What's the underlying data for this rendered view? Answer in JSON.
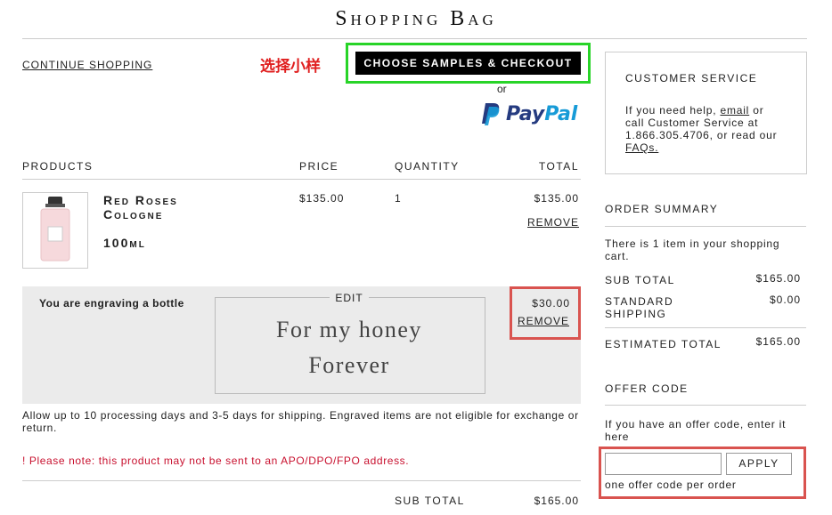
{
  "page": {
    "title": "Shopping Bag"
  },
  "top": {
    "continue_label": "CONTINUE SHOPPING",
    "annotation_cn": "选择小样",
    "checkout_label": "CHOOSE SAMPLES & CHECKOUT",
    "or": "or",
    "paypal_pay": "Pay",
    "paypal_pal": "Pal"
  },
  "table": {
    "headers": {
      "products": "PRODUCTS",
      "price": "PRICE",
      "quantity": "QUANTITY",
      "total": "TOTAL"
    },
    "item": {
      "name_line1": "Red Roses",
      "name_line2": "Cologne",
      "size": "100ml",
      "price": "$135.00",
      "quantity": "1",
      "total": "$135.00",
      "remove": "REMOVE"
    },
    "engraving": {
      "label": "You are engraving a bottle",
      "edit": "EDIT",
      "line1": "For my honey",
      "line2": "Forever",
      "price": "$30.00",
      "remove": "REMOVE"
    },
    "shipping_note": "Allow up to 10 processing days and 3-5 days for shipping. Engraved items are not eligible for exchange or return.",
    "apo_note": "! Please note: this product may not be sent to an APO/DPO/FPO address.",
    "sub_total_label": "SUB TOTAL",
    "sub_total_value": "$165.00"
  },
  "customer_service": {
    "title": "CUSTOMER SERVICE",
    "text_before": "If you need help, ",
    "email": "email",
    "text_middle": " or call Customer Service at 1.866.305.4706, or read our ",
    "faqs": "FAQs."
  },
  "order_summary": {
    "title": "ORDER SUMMARY",
    "items_text": "There is 1 item in your shopping cart.",
    "sub_total_label": "SUB TOTAL",
    "sub_total_value": "$165.00",
    "shipping_label_1": "STANDARD",
    "shipping_label_2": "SHIPPING",
    "shipping_value": "$0.00",
    "estimated_label": "ESTIMATED TOTAL",
    "estimated_value": "$165.00"
  },
  "offer": {
    "title": "OFFER CODE",
    "hint": "If you have an offer code, enter it here",
    "input_value": "",
    "apply_label": "APPLY",
    "note": "one offer code per order"
  }
}
